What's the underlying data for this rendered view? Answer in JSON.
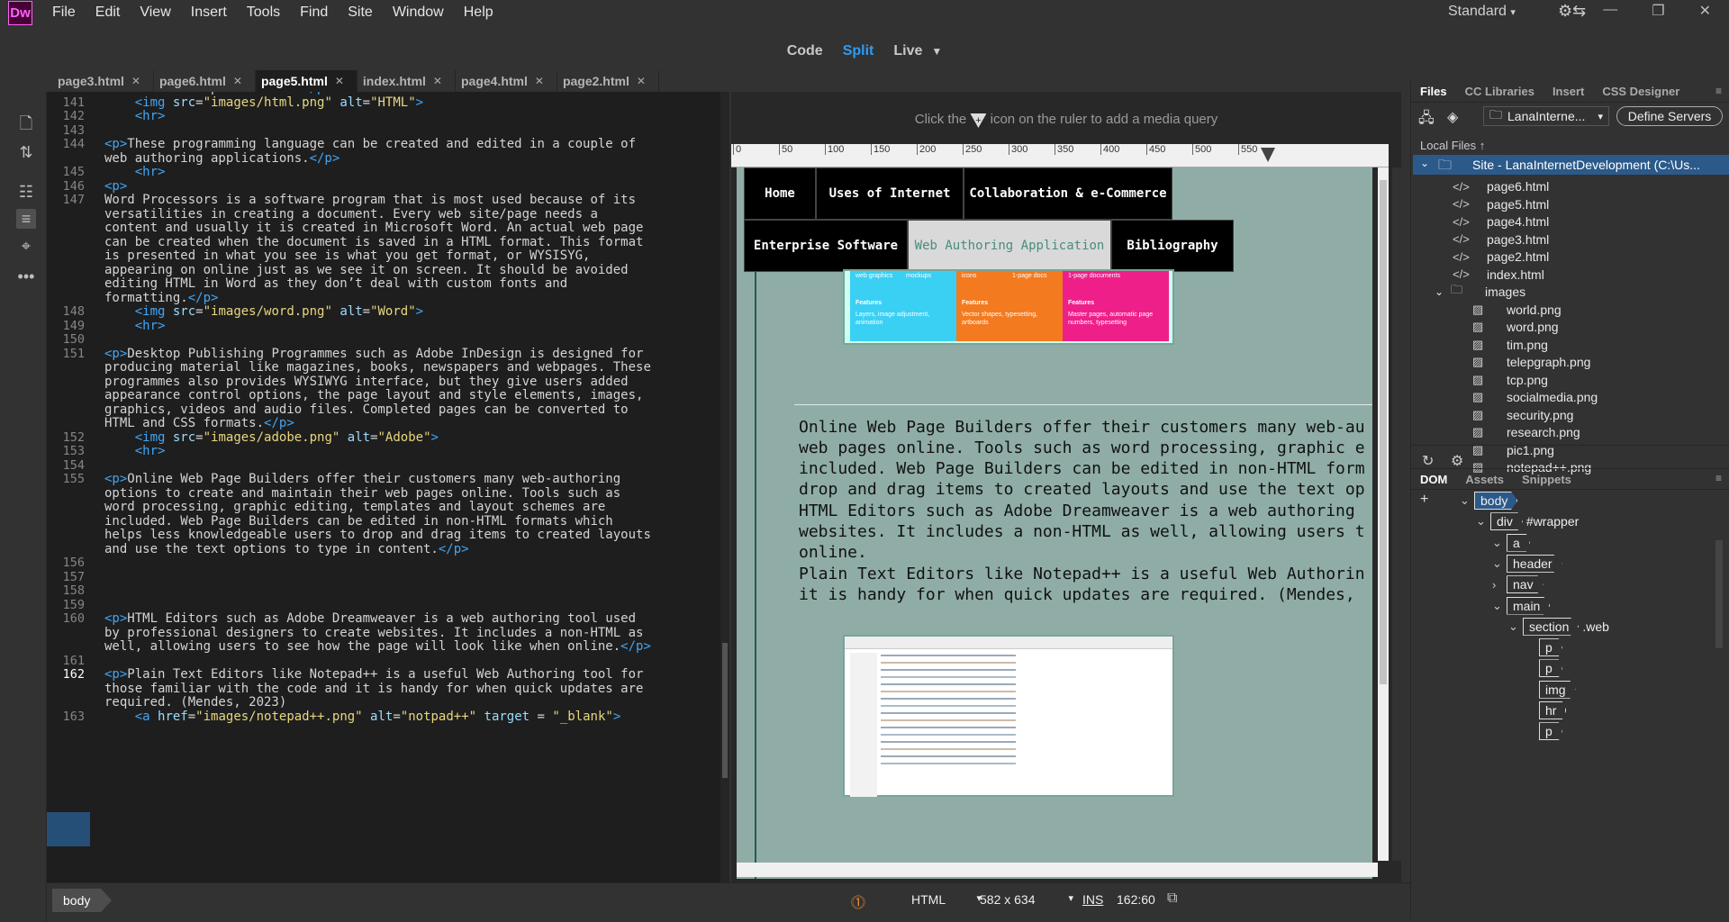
{
  "app": {
    "logo": "Dw",
    "menu": [
      "File",
      "Edit",
      "View",
      "Insert",
      "Tools",
      "Find",
      "Site",
      "Window",
      "Help"
    ],
    "workspace": "Standard"
  },
  "views": {
    "code": "Code",
    "split": "Split",
    "live": "Live"
  },
  "tabs": [
    "page3.html",
    "page6.html",
    "page5.html",
    "index.html",
    "page4.html",
    "page2.html"
  ],
  "active_tab": "page5.html",
  "code": {
    "cursor_line": "162",
    "lines": [
      {
        "n": "",
        "t": "stored in a separate file.</p>"
      },
      {
        "n": "141",
        "t": "    <img src=\"images/html.png\" alt=\"HTML\">"
      },
      {
        "n": "142",
        "t": "    <hr>"
      },
      {
        "n": "143",
        "t": ""
      },
      {
        "n": "144",
        "t": "<p>These programming language can be created and edited in a couple of"
      },
      {
        "n": "",
        "t": "web authoring applications.</p>"
      },
      {
        "n": "145",
        "t": "    <hr>"
      },
      {
        "n": "146",
        "t": "<p>"
      },
      {
        "n": "147",
        "t": "Word Processors is a software program that is most used because of its"
      },
      {
        "n": "",
        "t": "versatilities in creating a document. Every web site/page needs a"
      },
      {
        "n": "",
        "t": "content and usually it is created in Microsoft Word. An actual web page"
      },
      {
        "n": "",
        "t": "can be created when the document is saved in a HTML format. This format"
      },
      {
        "n": "",
        "t": "is presented in what you see is what you get format, or WYSISYG,"
      },
      {
        "n": "",
        "t": "appearing on online just as we see it on screen. It should be avoided"
      },
      {
        "n": "",
        "t": "editing HTML in Word as they don’t deal with custom fonts and"
      },
      {
        "n": "",
        "t": "formatting.</p>"
      },
      {
        "n": "148",
        "t": "    <img src=\"images/word.png\" alt=\"Word\">"
      },
      {
        "n": "149",
        "t": "    <hr>"
      },
      {
        "n": "150",
        "t": ""
      },
      {
        "n": "151",
        "t": "<p>Desktop Publishing Programmes such as Adobe InDesign is designed for"
      },
      {
        "n": "",
        "t": "producing material like magazines, books, newspapers and webpages. These"
      },
      {
        "n": "",
        "t": "programmes also provides WYSIWYG interface, but they give users added"
      },
      {
        "n": "",
        "t": "appearance control options, the page layout and style elements, images,"
      },
      {
        "n": "",
        "t": "graphics, videos and audio files. Completed pages can be converted to"
      },
      {
        "n": "",
        "t": "HTML and CSS formats.</p>"
      },
      {
        "n": "152",
        "t": "    <img src=\"images/adobe.png\" alt=\"Adobe\">"
      },
      {
        "n": "153",
        "t": "    <hr>"
      },
      {
        "n": "154",
        "t": ""
      },
      {
        "n": "155",
        "t": "<p>Online Web Page Builders offer their customers many web-authoring"
      },
      {
        "n": "",
        "t": "options to create and maintain their web pages online. Tools such as"
      },
      {
        "n": "",
        "t": "word processing, graphic editing, templates and layout schemes are"
      },
      {
        "n": "",
        "t": "included. Web Page Builders can be edited in non-HTML formats which"
      },
      {
        "n": "",
        "t": "helps less knowledgeable users to drop and drag items to created layouts"
      },
      {
        "n": "",
        "t": "and use the text options to type in content.</p>"
      },
      {
        "n": "156",
        "t": ""
      },
      {
        "n": "157",
        "t": ""
      },
      {
        "n": "158",
        "t": ""
      },
      {
        "n": "159",
        "t": ""
      },
      {
        "n": "160",
        "t": "<p>HTML Editors such as Adobe Dreamweaver is a web authoring tool used"
      },
      {
        "n": "",
        "t": "by professional designers to create websites. It includes a non-HTML as"
      },
      {
        "n": "",
        "t": "well, allowing users to see how the page will look like when online.</p>"
      },
      {
        "n": "161",
        "t": ""
      },
      {
        "n": "162",
        "t": "<p>Plain Text Editors like Notepad++ is a useful Web Authoring tool for"
      },
      {
        "n": "",
        "t": "those familiar with the code and it is handy for when quick updates are"
      },
      {
        "n": "",
        "t": "required. (Mendes, 2023)"
      },
      {
        "n": "163",
        "t": "    <a href=\"images/notepad++.png\" alt=\"notpad++\" target = \"_blank\">"
      }
    ]
  },
  "design": {
    "mq_prefix": "Click the",
    "mq_suffix": "icon on the ruler to add a media query",
    "ruler": [
      "0",
      "50",
      "100",
      "150",
      "200",
      "250",
      "300",
      "350",
      "400",
      "450",
      "500",
      "550"
    ],
    "nav": [
      "Home",
      "Uses of Internet",
      "Collaboration & e-Commerce",
      "Enterprise Software",
      "Web Authoring Application",
      "Bibliography"
    ],
    "tiles": [
      {
        "title": "Features",
        "text": "Layers, image adjustment, animation",
        "top": "web graphics",
        "top2": "mockups",
        "color": "#3ad0f4"
      },
      {
        "title": "Features",
        "text": "Vector shapes, typesetting, artboards",
        "top": "icons",
        "top2": "1-page docs",
        "color": "#f47a1f"
      },
      {
        "title": "Features",
        "text": "Master pages, automatic page numbers, typesetting",
        "top": "1-page documents",
        "top2": "",
        "color": "#ef1f8a"
      }
    ],
    "paras": [
      "Online Web Page Builders offer their customers many web-au\nweb pages online. Tools such as word processing, graphic e\nincluded. Web Page Builders can be edited in non-HTML form\ndrop and drag items to created layouts and use the text op",
      "HTML Editors such as Adobe Dreamweaver is a web authoring \nwebsites. It includes a non-HTML as well, allowing users t\nonline.",
      "Plain Text Editors like Notepad++ is a useful Web Authorin\nit is handy for when quick updates are required. (Mendes, "
    ]
  },
  "files_panel": {
    "tabs": [
      "Files",
      "CC Libraries",
      "Insert",
      "CSS Designer"
    ],
    "site_select": "LanaInterne...",
    "define_servers": "Define Servers",
    "local_files": "Local Files",
    "site_root": "Site - LanaInternetDevelopment (C:\\Us...",
    "html_files": [
      "page6.html",
      "page5.html",
      "page4.html",
      "page3.html",
      "page2.html",
      "index.html"
    ],
    "folder": "images",
    "images": [
      "world.png",
      "word.png",
      "tim.png",
      "telepgraph.png",
      "tcp.png",
      "socialmedia.png",
      "security.png",
      "research.png",
      "pic1.png",
      "notepad++.png"
    ]
  },
  "dom_panel": {
    "tabs": [
      "DOM",
      "Assets",
      "Snippets"
    ],
    "nodes": [
      {
        "tag": "body",
        "suffix": "",
        "depth": 0,
        "sel": true
      },
      {
        "tag": "div",
        "suffix": "#wrapper",
        "depth": 1,
        "sel": false
      },
      {
        "tag": "a",
        "suffix": "",
        "depth": 2,
        "sel": false
      },
      {
        "tag": "header",
        "suffix": "",
        "depth": 2,
        "sel": false
      },
      {
        "tag": "nav",
        "suffix": "",
        "depth": 2,
        "sel": false
      },
      {
        "tag": "main",
        "suffix": "",
        "depth": 2,
        "sel": false
      },
      {
        "tag": "section",
        "suffix": ".web",
        "depth": 3,
        "sel": false
      },
      {
        "tag": "p",
        "suffix": "",
        "depth": 4,
        "sel": false
      },
      {
        "tag": "p",
        "suffix": "",
        "depth": 4,
        "sel": false
      },
      {
        "tag": "img",
        "suffix": "",
        "depth": 4,
        "sel": false
      },
      {
        "tag": "hr",
        "suffix": "",
        "depth": 4,
        "sel": false
      },
      {
        "tag": "p",
        "suffix": "",
        "depth": 4,
        "sel": false
      }
    ]
  },
  "status": {
    "crumb": "body",
    "language": "HTML",
    "size": "582 x 634",
    "mode": "INS",
    "position": "162:60"
  }
}
